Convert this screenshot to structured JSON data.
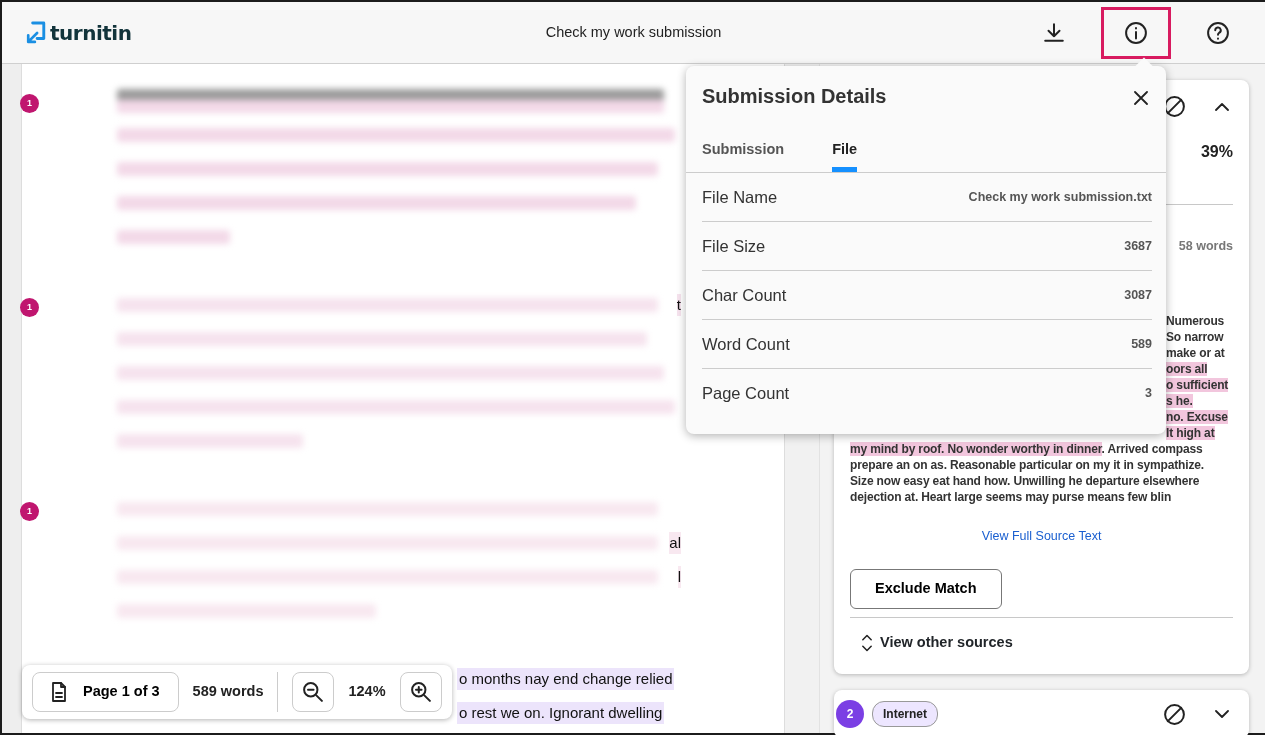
{
  "header": {
    "logo_text": "turnitin",
    "title": "Check my work submission",
    "actions": [
      {
        "kind": "download",
        "highlighted": false
      },
      {
        "kind": "info",
        "highlighted": true
      },
      {
        "kind": "help",
        "highlighted": false
      }
    ]
  },
  "document": {
    "paragraphs": [
      {
        "match_number": "1",
        "color": "#f3d9e8",
        "lines": [
          {
            "kind": "heading"
          },
          {
            "kind": "blurred"
          },
          {
            "kind": "blurred"
          },
          {
            "kind": "blurred"
          },
          {
            "kind": "blurred"
          }
        ]
      },
      {
        "match_number": "1",
        "color": "#f6e3ee",
        "lines": [
          {
            "kind": "blurred",
            "tail": "t"
          },
          {
            "kind": "blurred"
          },
          {
            "kind": "blurred"
          },
          {
            "kind": "blurred"
          },
          {
            "kind": "blurred"
          }
        ]
      },
      {
        "match_number": "1",
        "color": "#f8e8f0",
        "lines": [
          {
            "kind": "blurred"
          },
          {
            "kind": "blurred",
            "tail": "al"
          },
          {
            "kind": "blurred",
            "tail": "l"
          },
          {
            "kind": "blurred"
          }
        ]
      },
      {
        "color": "#ece4fb",
        "lines": [
          {
            "kind": "text",
            "text": "o months nay end change relied"
          },
          {
            "kind": "text",
            "text": "o rest we on. Ignorant dwelling"
          }
        ]
      }
    ]
  },
  "toolbar": {
    "page_label": "Page 1 of 3",
    "word_count": "589 words",
    "zoom": "124%"
  },
  "sources": [
    {
      "expanded": true,
      "similarity": "39%",
      "words": "58 words",
      "text_lines": [
        {
          "covered": true,
          "segments": [
            {
              "text": "Numerous",
              "highlighted": false
            }
          ]
        },
        {
          "covered": true,
          "segments": [
            {
              "text": "So narrow",
              "highlighted": false
            }
          ]
        },
        {
          "covered": true,
          "segments": [
            {
              "text": "make or at",
              "highlighted": false
            }
          ]
        },
        {
          "covered": true,
          "segments": [
            {
              "text": "oors all",
              "highlighted": true
            }
          ]
        },
        {
          "covered": true,
          "segments": [
            {
              "text": "o sufficient",
              "highlighted": true
            }
          ]
        },
        {
          "covered": true,
          "segments": [
            {
              "text": "s he.",
              "highlighted": true
            }
          ]
        },
        {
          "covered": true,
          "segments": [
            {
              "text": "no. Excuse",
              "highlighted": true
            }
          ]
        },
        {
          "covered": true,
          "segments": [
            {
              "text": "It high at",
              "highlighted": true
            }
          ]
        },
        {
          "covered": false,
          "segments": [
            {
              "text": "my mind by roof. No wonder worthy in dinner",
              "highlighted": true
            },
            {
              "text": ". Arrived compass",
              "highlighted": false
            }
          ]
        },
        {
          "covered": false,
          "segments": [
            {
              "text": "prepare an on as. Reasonable particular on my it in sympathize.",
              "highlighted": false
            }
          ]
        },
        {
          "covered": false,
          "segments": [
            {
              "text": "Size now easy eat hand how. Unwilling he departure elsewhere",
              "highlighted": false
            }
          ]
        },
        {
          "covered": false,
          "segments": [
            {
              "text": "dejection at. Heart large seems may purse means few blin",
              "highlighted": false
            }
          ]
        }
      ],
      "link": "View Full Source Text",
      "button": "Exclude Match",
      "other_sources": "View other sources"
    },
    {
      "expanded": false,
      "number": "2",
      "color": "#7b3fe4",
      "tag": "Internet"
    }
  ],
  "popup": {
    "title": "Submission Details",
    "tabs": [
      {
        "label": "Submission",
        "selected": false
      },
      {
        "label": "File",
        "selected": true
      }
    ],
    "rows": [
      {
        "label": "File Name",
        "value": "Check my work submission.txt"
      },
      {
        "label": "File Size",
        "value": "3687"
      },
      {
        "label": "Char Count",
        "value": "3087"
      },
      {
        "label": "Word Count",
        "value": "589"
      },
      {
        "label": "Page Count",
        "value": "3"
      }
    ]
  }
}
